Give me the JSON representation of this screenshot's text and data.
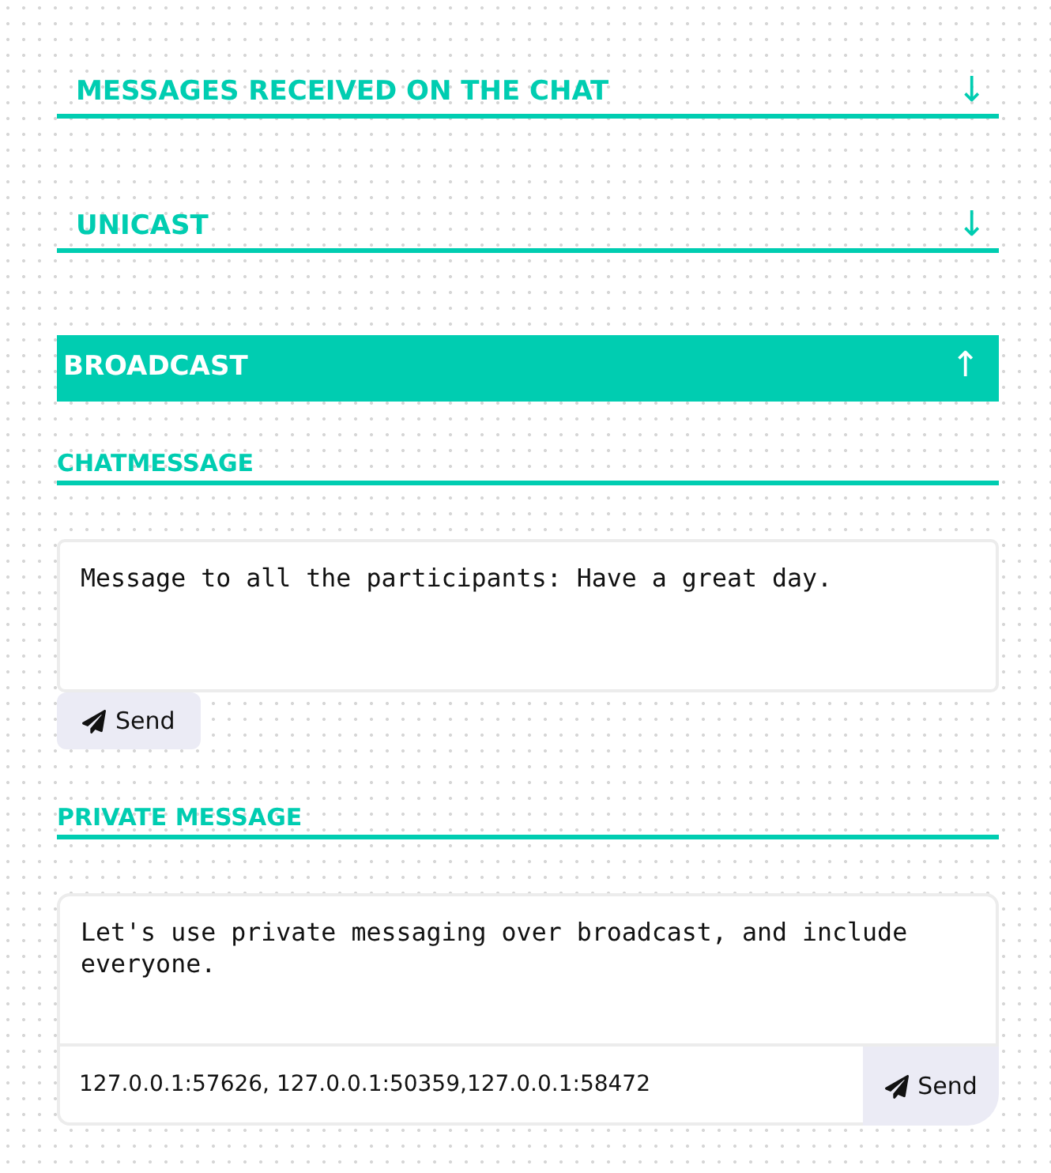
{
  "sections": [
    {
      "title": "MESSAGES RECEIVED ON THE CHAT",
      "arrow": "↓",
      "expanded": false
    },
    {
      "title": "UNICAST",
      "arrow": "↓",
      "expanded": false
    },
    {
      "title": "BROADCAST",
      "arrow": "↑",
      "expanded": true,
      "forms": [
        {
          "kind": "chat",
          "title": "CHATMESSAGE",
          "message": "Message to all the participants: Have a great day.",
          "button": "Send"
        },
        {
          "kind": "private",
          "title": "PRIVATE MESSAGE",
          "message": "Let's use private messaging over broadcast, and include everyone.",
          "recipients": "127.0.0.1:57626, 127.0.0.1:50359,127.0.0.1:58472",
          "button": "Send"
        }
      ]
    }
  ]
}
